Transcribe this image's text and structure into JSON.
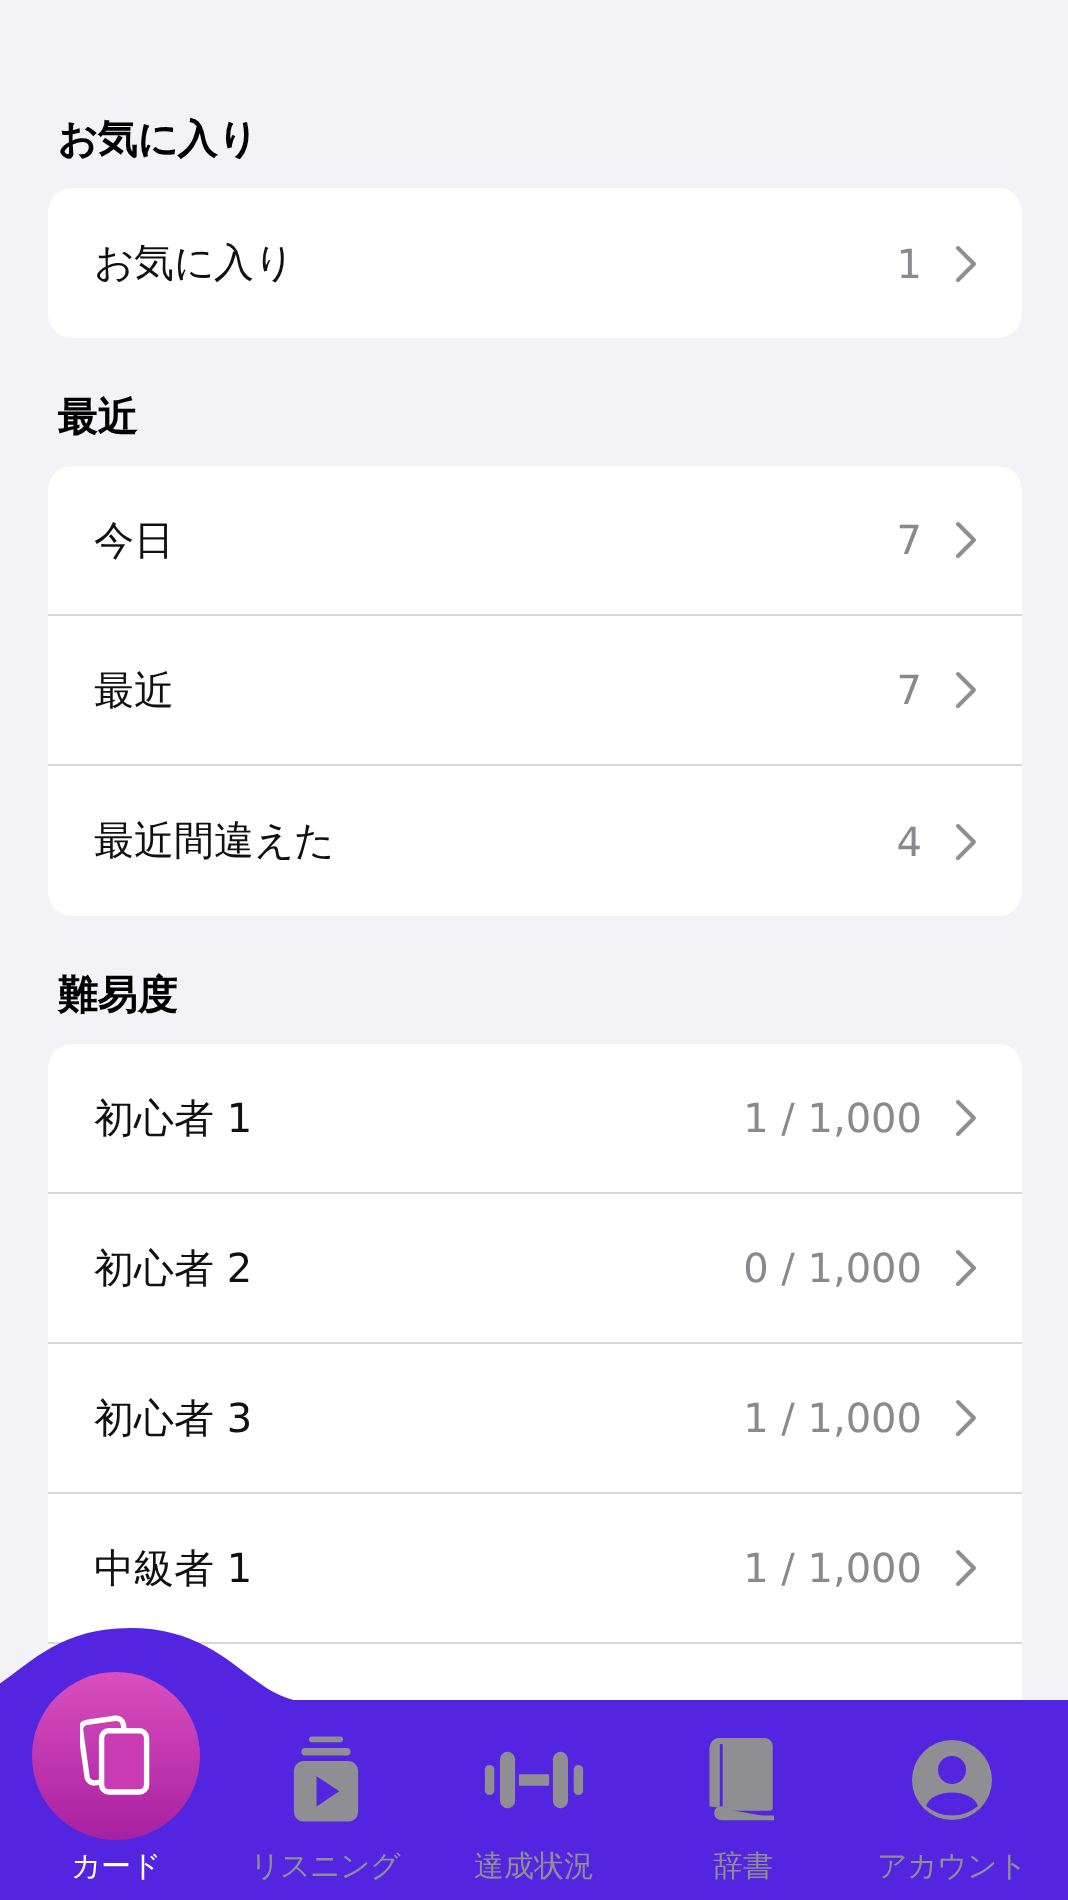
{
  "sections": [
    {
      "title": "お気に入り",
      "rows": [
        {
          "label": "お気に入り",
          "count": "1"
        }
      ]
    },
    {
      "title": "最近",
      "rows": [
        {
          "label": "今日",
          "count": "7"
        },
        {
          "label": "最近",
          "count": "7"
        },
        {
          "label": "最近間違えた",
          "count": "4"
        }
      ]
    },
    {
      "title": "難易度",
      "rows": [
        {
          "label": "初心者 1",
          "count": "1 / 1,000"
        },
        {
          "label": "初心者 2",
          "count": "0 / 1,000"
        },
        {
          "label": "初心者 3",
          "count": "1 / 1,000"
        },
        {
          "label": "中級者 1",
          "count": "1 / 1,000"
        }
      ],
      "more_below": true
    }
  ],
  "tabs": [
    {
      "label": "カード",
      "kind": "cards",
      "selected": true
    },
    {
      "label": "リスニング",
      "kind": "listening",
      "selected": false
    },
    {
      "label": "達成状況",
      "kind": "progress",
      "selected": false
    },
    {
      "label": "辞書",
      "kind": "dictionary",
      "selected": false
    },
    {
      "label": "アカウント",
      "kind": "account",
      "selected": false
    }
  ]
}
